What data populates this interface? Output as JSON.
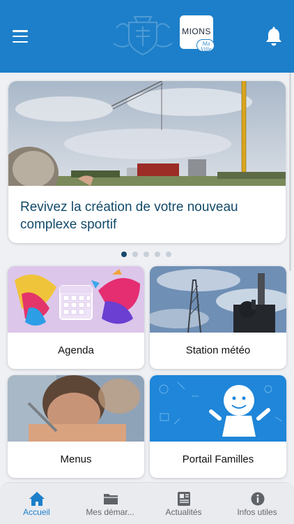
{
  "header": {
    "menu_icon": "hamburger-icon",
    "crest_icon": "city-crest-icon",
    "logo_text": "MIONS",
    "logo_script": "Ma Ville",
    "notification_icon": "bell-icon",
    "background": "#1d7fc9"
  },
  "carousel": {
    "title": "Revivez la création de votre nouveau complexe sportif",
    "dot_count": 5,
    "active_index": 0
  },
  "tiles": [
    {
      "label": "Agenda",
      "icon": "calendar-icon"
    },
    {
      "label": "Station météo",
      "icon": "weather-station-icon"
    },
    {
      "label": "Menus",
      "icon": "school-meal-icon"
    },
    {
      "label": "Portail Familles",
      "icon": "family-portal-icon"
    }
  ],
  "bottom_nav": [
    {
      "label": "Accueil",
      "icon": "home-icon",
      "active": true
    },
    {
      "label": "Mes démar...",
      "icon": "folder-icon",
      "active": false
    },
    {
      "label": "Actualités",
      "icon": "newspaper-icon",
      "active": false
    },
    {
      "label": "Infos utiles",
      "icon": "info-icon",
      "active": false
    }
  ],
  "colors": {
    "accent": "#1d7fc9",
    "title_text": "#124a6a",
    "active_dot": "#16466b",
    "inactive_dot": "#c7cfd9"
  }
}
